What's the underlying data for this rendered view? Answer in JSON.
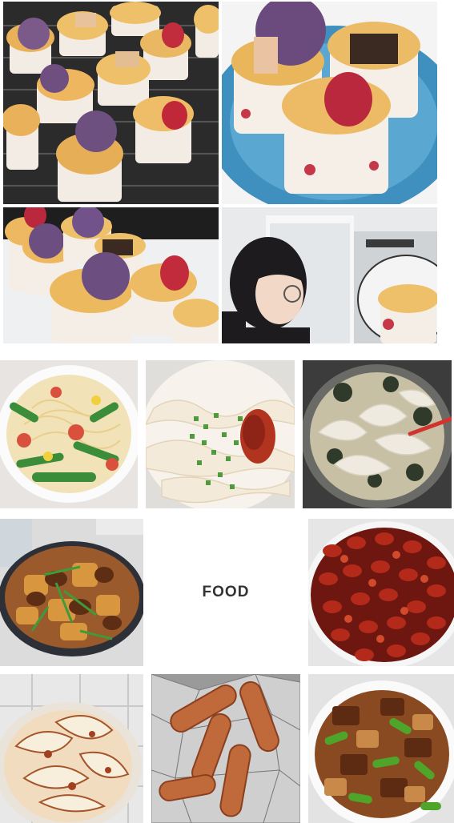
{
  "label": {
    "text": "FOOD"
  },
  "photos": [
    {
      "subject": "cupcakes-on-rack"
    },
    {
      "subject": "cupcakes-on-blue-plate"
    },
    {
      "subject": "cupcakes-on-tray"
    },
    {
      "subject": "girl-with-glasses-selfie"
    },
    {
      "subject": "noodles-with-greens-and-tomato"
    },
    {
      "subject": "noodles-with-scallion-and-chili"
    },
    {
      "subject": "wonton-soup"
    },
    {
      "subject": "braised-chicken-and-potatoes"
    },
    {
      "subject": "spicy-crayfish"
    },
    {
      "subject": "stir-fried-cabbage"
    },
    {
      "subject": "sausages-on-foil"
    },
    {
      "subject": "braised-meat-with-green-peppers"
    }
  ],
  "colors": {
    "background": "#ffffff",
    "label_text": "#333333"
  }
}
